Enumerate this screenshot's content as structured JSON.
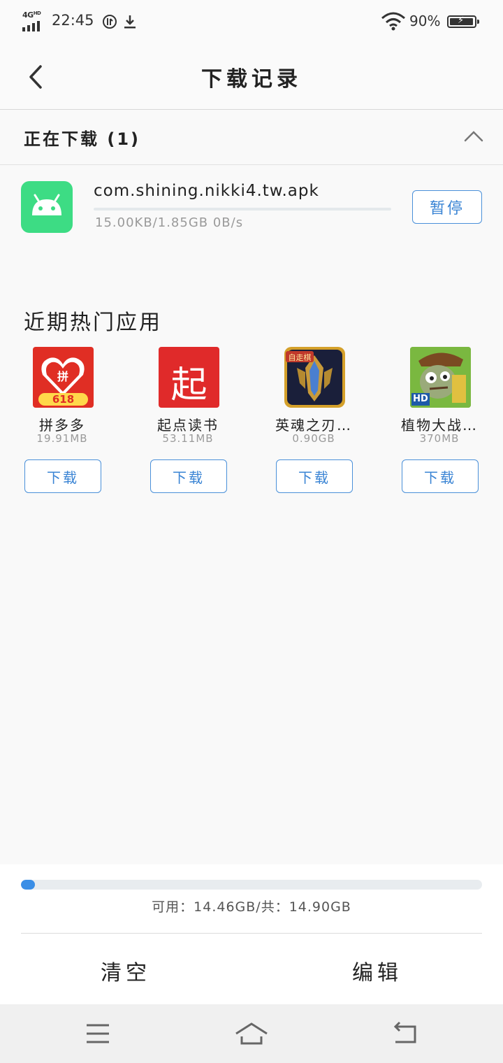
{
  "status_bar": {
    "network": "4G",
    "network_sup": "HD",
    "time": "22:45",
    "battery": "90%"
  },
  "header": {
    "title": "下载记录"
  },
  "downloading": {
    "section_title": "正在下载 (1)",
    "item": {
      "name": "com.shining.nikki4.tw.apk",
      "meta": "15.00KB/1.85GB 0B/s",
      "progress_fraction": 0.0,
      "pause_label": "暂停"
    }
  },
  "hot_apps": {
    "title": "近期热门应用",
    "items": [
      {
        "name": "拼多多",
        "size": "19.91MB",
        "button": "下载",
        "icon_badge": "618"
      },
      {
        "name": "起点读书",
        "size": "53.11MB",
        "button": "下载",
        "icon_char": "起"
      },
      {
        "name": "英魂之刃…",
        "size": "0.90GB",
        "button": "下载",
        "icon_badge": "自走棋"
      },
      {
        "name": "植物大战…",
        "size": "370MB",
        "button": "下载",
        "icon_badge": "HD"
      }
    ]
  },
  "storage": {
    "text": "可用：14.46GB/共：14.90GB",
    "used_fraction": 0.03
  },
  "actions": {
    "clear": "清空",
    "edit": "编辑"
  },
  "colors": {
    "accent": "#3a8ee6",
    "android_green": "#3ddc84"
  }
}
